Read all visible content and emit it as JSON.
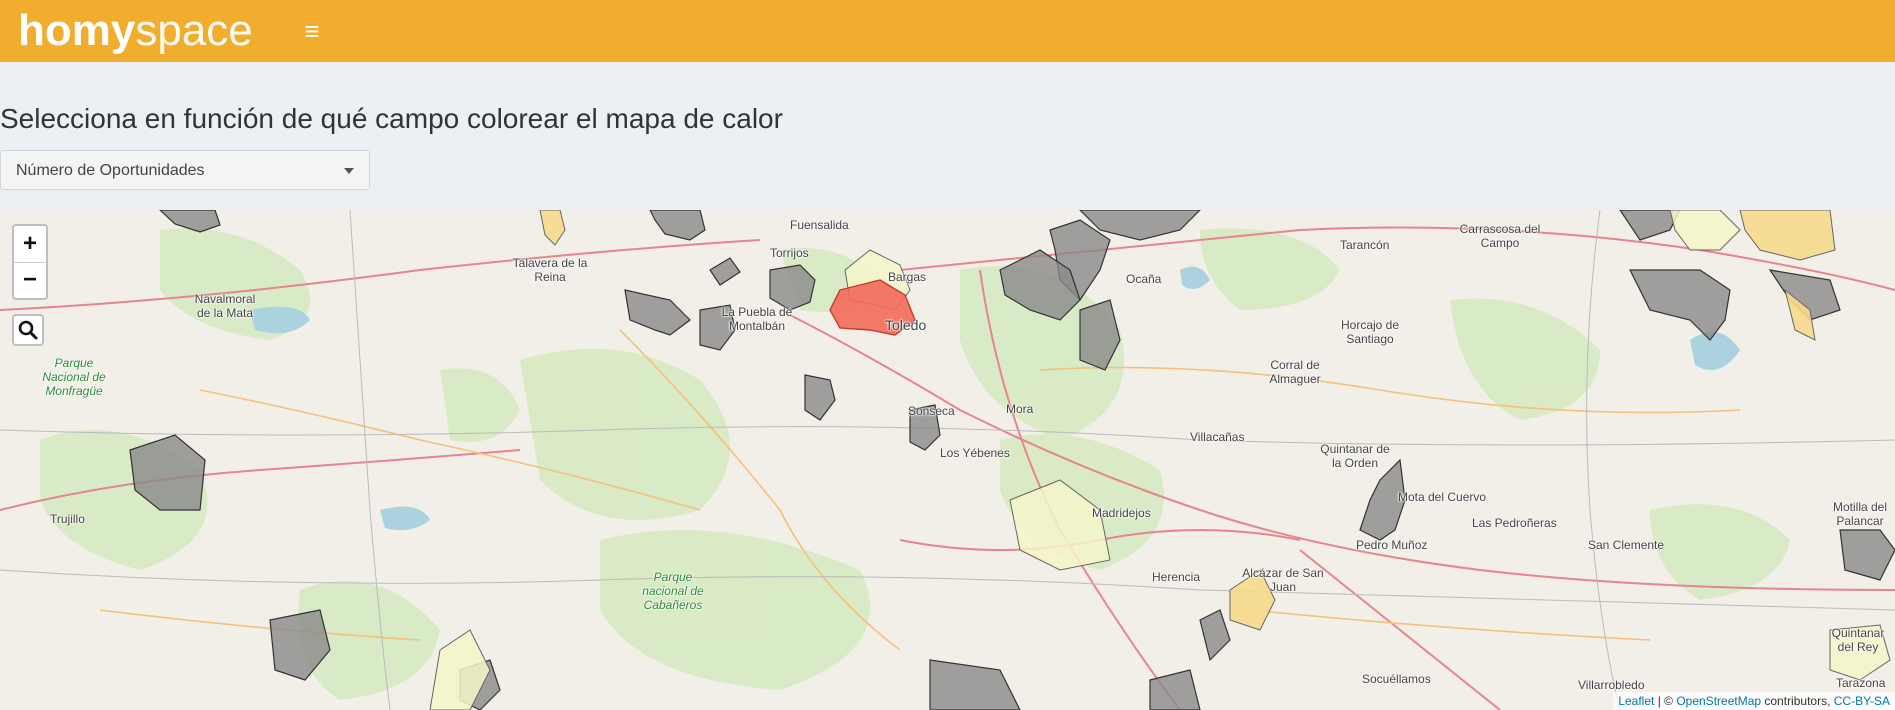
{
  "header": {
    "logo_part1": "homy",
    "logo_part2": "space",
    "menu_icon": "hamburger-menu-icon",
    "background_color": "#f0ad2e"
  },
  "main": {
    "title": "Selecciona en función de qué campo colorear el mapa de calor",
    "field_select": {
      "selected": "Número de Oportunidades"
    }
  },
  "map": {
    "controls": {
      "zoom_in": "+",
      "zoom_out": "−",
      "search_icon": "magnifier-search-icon"
    },
    "attribution": {
      "leaflet": "Leaflet",
      "separator": " | © ",
      "osm": "OpenStreetMap",
      "contributors": " contributors, ",
      "license": "CC-BY-SA"
    },
    "place_labels": [
      {
        "text": "Fuensalida"
      },
      {
        "text": "Torrijos"
      },
      {
        "text": "Bargas"
      },
      {
        "text": "Talavera de la Reina"
      },
      {
        "text": "Navalmoral de la Mata"
      },
      {
        "text": "La Puebla de Montalbán"
      },
      {
        "text": "Toledo"
      },
      {
        "text": "Ocaña"
      },
      {
        "text": "Tarancón"
      },
      {
        "text": "Carrascosa del Campo"
      },
      {
        "text": "Horcajo de Santiago"
      },
      {
        "text": "Corral de Almaguer"
      },
      {
        "text": "Sonseca"
      },
      {
        "text": "Mora"
      },
      {
        "text": "Los Yébenes"
      },
      {
        "text": "Villacañas"
      },
      {
        "text": "Quintanar de la Orden"
      },
      {
        "text": "Mota del Cuervo"
      },
      {
        "text": "Las Pedroñeras"
      },
      {
        "text": "Trujillo"
      },
      {
        "text": "Madridejos"
      },
      {
        "text": "Alcázar de San Juan"
      },
      {
        "text": "Herencia"
      },
      {
        "text": "Pedro Muñoz"
      },
      {
        "text": "San Clemente"
      },
      {
        "text": "Socuéllamos"
      },
      {
        "text": "Villarrobledo"
      },
      {
        "text": "Motilla del Palancar"
      },
      {
        "text": "Quintanar del Rey"
      },
      {
        "text": "Tarazona"
      }
    ],
    "park_labels": [
      {
        "text": "Parque Nacional de Monfragüe"
      },
      {
        "text": "Parque nacional de Cabañeros"
      }
    ],
    "heat_colors": {
      "high": "#f26a5a",
      "medium": "#f7d98c",
      "low": "#f5f5c8",
      "none": "#8a8a8a"
    }
  }
}
